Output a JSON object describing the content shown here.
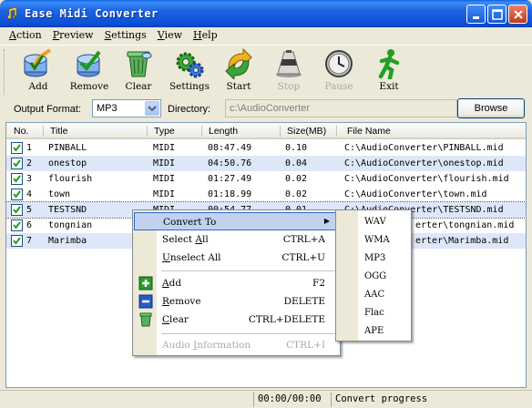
{
  "window": {
    "title": "Ease Midi Converter"
  },
  "menubar": [
    {
      "u": "A",
      "rest": "ction"
    },
    {
      "u": "P",
      "rest": "review"
    },
    {
      "u": "S",
      "rest": "ettings"
    },
    {
      "u": "V",
      "rest": "iew"
    },
    {
      "u": "H",
      "rest": "elp"
    }
  ],
  "toolbar": {
    "add": "Add",
    "remove": "Remove",
    "clear": "Clear",
    "settings": "Settings",
    "start": "Start",
    "stop": "Stop",
    "pause": "Pause",
    "exit": "Exit"
  },
  "format_row": {
    "output_format_label": "Output Format:",
    "output_format_value": "MP3",
    "directory_label": "Directory:",
    "directory_value": "c:\\AudioConverter",
    "browse_label": "Browse"
  },
  "list": {
    "columns": [
      "No.",
      "Title",
      "Type",
      "Length",
      "Size(MB)",
      "File Name"
    ],
    "rows": [
      {
        "no": "1",
        "title": "PINBALL",
        "type": "MIDI",
        "length": "08:47.49",
        "size": "0.10",
        "file": "C:\\AudioConverter\\PINBALL.mid"
      },
      {
        "no": "2",
        "title": "onestop",
        "type": "MIDI",
        "length": "04:50.76",
        "size": "0.04",
        "file": "C:\\AudioConverter\\onestop.mid"
      },
      {
        "no": "3",
        "title": "flourish",
        "type": "MIDI",
        "length": "01:27.49",
        "size": "0.02",
        "file": "C:\\AudioConverter\\flourish.mid"
      },
      {
        "no": "4",
        "title": "town",
        "type": "MIDI",
        "length": "01:18.99",
        "size": "0.02",
        "file": "C:\\AudioConverter\\town.mid"
      },
      {
        "no": "5",
        "title": "TESTSND",
        "type": "MIDI",
        "length": "00:54.77",
        "size": "0.01",
        "file": "C:\\AudioConverter\\TESTSND.mid"
      },
      {
        "no": "6",
        "title": "tongnian",
        "type": "MIDI",
        "length": "",
        "size": "",
        "file": "erter\\tongnian.mid"
      },
      {
        "no": "7",
        "title": "Marimba",
        "type": "",
        "length": "",
        "size": "",
        "file": "erter\\Marimba.mid"
      }
    ]
  },
  "context_menu": {
    "convert_to": "Convert To",
    "select_all_u": "A",
    "select_all_pre": "Select ",
    "select_all_post": "ll",
    "select_all_sc": "CTRL+A",
    "unselect_all_u": "U",
    "unselect_all_post": "nselect All",
    "unselect_all_sc": "CTRL+U",
    "add_u": "A",
    "add_post": "dd",
    "add_sc": "F2",
    "remove_u": "R",
    "remove_post": "emove",
    "remove_sc": "DELETE",
    "clear_u": "C",
    "clear_post": "lear",
    "clear_sc": "CTRL+DELETE",
    "audio_info_pre": "Audio ",
    "audio_info_u": "I",
    "audio_info_post": "nformation",
    "audio_info_sc": "CTRL+I"
  },
  "submenu": [
    "WAV",
    "WMA",
    "MP3",
    "OGG",
    "AAC",
    "Flac",
    "APE"
  ],
  "status": {
    "time": "00:00/00:00",
    "progress_label": "Convert progress"
  },
  "colors": {
    "title_blue": "#0c4fd6",
    "selection": "#dde7f8",
    "menu_highlight": "#c1d2ee"
  }
}
